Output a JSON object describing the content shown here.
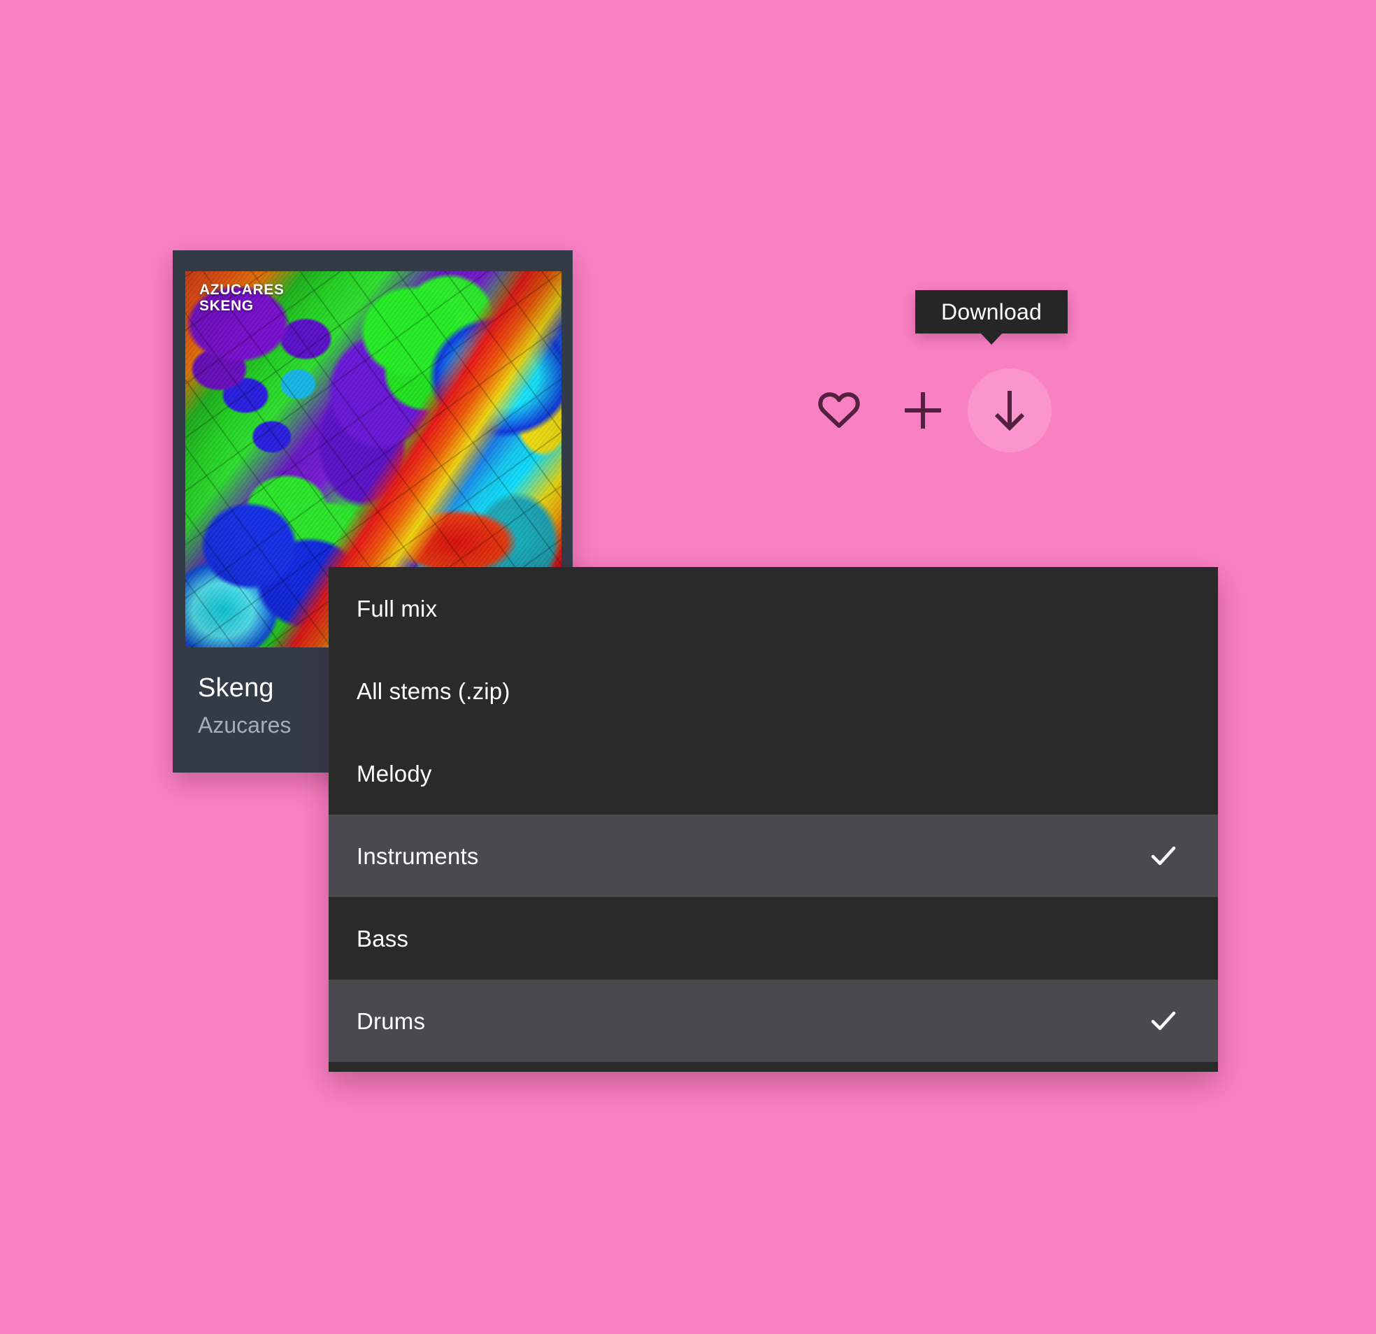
{
  "background_color": "#fa80c4",
  "track_card": {
    "artwork": {
      "wordmark": "AZUCARES\nSKENG",
      "icon": "album-artwork"
    },
    "title": "Skeng",
    "artist": "Azucares"
  },
  "actions": {
    "like": {
      "icon": "heart-icon",
      "label": "Like"
    },
    "add": {
      "icon": "plus-icon",
      "label": "Add"
    },
    "download": {
      "icon": "download-arrow-icon",
      "label": "Download",
      "active": true
    }
  },
  "tooltip": {
    "text": "Download",
    "background_color": "#262626",
    "text_color": "#ffffff"
  },
  "download_menu": {
    "background_color": "#2a2a2a",
    "selected_background_color": "#4a4a4e",
    "check_icon": "check-icon",
    "items": [
      {
        "label": "Full mix",
        "selected": false
      },
      {
        "label": "All stems (.zip)",
        "selected": false
      },
      {
        "label": "Melody",
        "selected": false
      },
      {
        "label": "Instruments",
        "selected": true
      },
      {
        "label": "Bass",
        "selected": false
      },
      {
        "label": "Drums",
        "selected": true
      }
    ]
  }
}
